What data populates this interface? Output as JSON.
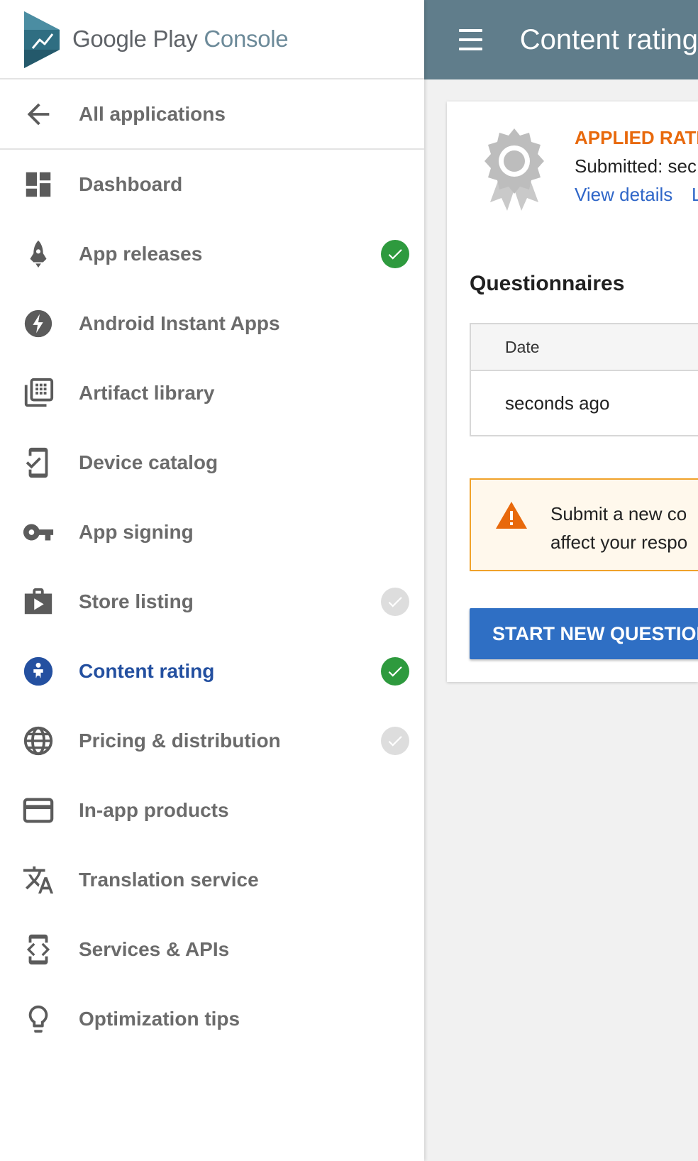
{
  "brand": {
    "name_main": "Google Play",
    "name_console": "Console"
  },
  "nav": {
    "back_label": "All applications",
    "items": [
      {
        "label": "Dashboard",
        "icon": "dashboard-icon",
        "status": null
      },
      {
        "label": "App releases",
        "icon": "rocket-icon",
        "status": "complete"
      },
      {
        "label": "Android Instant Apps",
        "icon": "lightning-icon",
        "status": null
      },
      {
        "label": "Artifact library",
        "icon": "library-icon",
        "status": null
      },
      {
        "label": "Device catalog",
        "icon": "device-check-icon",
        "status": null
      },
      {
        "label": "App signing",
        "icon": "key-icon",
        "status": null
      },
      {
        "label": "Store listing",
        "icon": "store-bag-icon",
        "status": "incomplete"
      },
      {
        "label": "Content rating",
        "icon": "content-rating-icon",
        "status": "complete",
        "active": true
      },
      {
        "label": "Pricing & distribution",
        "icon": "globe-icon",
        "status": "incomplete"
      },
      {
        "label": "In-app products",
        "icon": "credit-card-icon",
        "status": null
      },
      {
        "label": "Translation service",
        "icon": "translate-icon",
        "status": null
      },
      {
        "label": "Services & APIs",
        "icon": "code-icon",
        "status": null
      },
      {
        "label": "Optimization tips",
        "icon": "lightbulb-icon",
        "status": null
      }
    ]
  },
  "header": {
    "title": "Content rating"
  },
  "rating": {
    "heading": "APPLIED RATIN",
    "submitted": "Submitted: sec",
    "view_details": "View details",
    "second_link": "L"
  },
  "questionnaires": {
    "title": "Questionnaires",
    "column_date": "Date",
    "rows": [
      {
        "date": "seconds ago"
      }
    ]
  },
  "warning": {
    "line1": "Submit a new co",
    "line2": "affect your respo"
  },
  "actions": {
    "start_new": "START NEW QUESTION"
  },
  "colors": {
    "topbar": "#607d8b",
    "active_nav": "#2450a0",
    "complete": "#2e9a3e",
    "incomplete": "#dddddd",
    "warning_accent": "#e8690c",
    "primary_button": "#2f6fc4",
    "link": "#2f66c8"
  }
}
